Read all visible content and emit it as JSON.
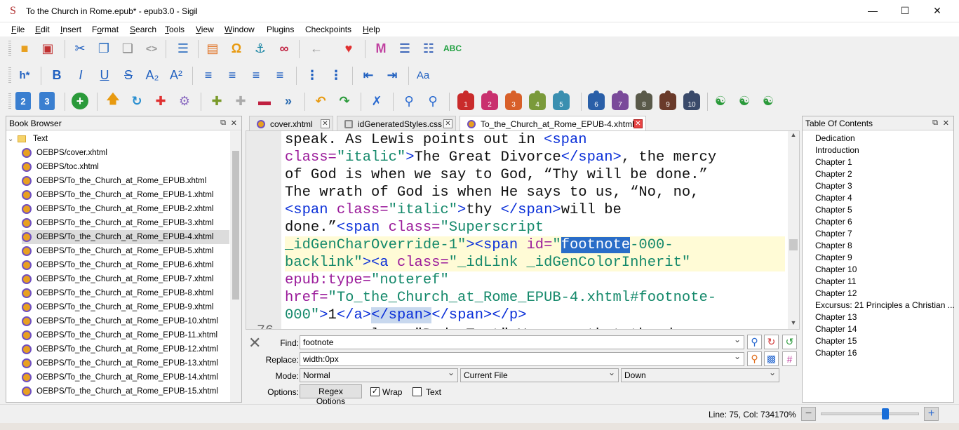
{
  "window": {
    "title": "To the Church in Rome.epub* - epub3.0 - Sigil",
    "minimize": "—",
    "maximize": "☐",
    "close": "✕",
    "app_icon": "sigil-icon"
  },
  "menu": [
    {
      "label": "File",
      "u": "F"
    },
    {
      "label": "Edit",
      "u": "E"
    },
    {
      "label": "Insert",
      "u": "I"
    },
    {
      "label": "Format",
      "u": "o"
    },
    {
      "label": "Search",
      "u": "S"
    },
    {
      "label": "Tools",
      "u": "T"
    },
    {
      "label": "View",
      "u": "V"
    },
    {
      "label": "Window",
      "u": "W"
    },
    {
      "label": "Plugins",
      "u": ""
    },
    {
      "label": "Checkpoints",
      "u": ""
    },
    {
      "label": "Help",
      "u": "H"
    }
  ],
  "toolbar": {
    "heading_label": "h*",
    "bold": "B",
    "italic": "I",
    "underline": "U",
    "strike": "S",
    "subscript": "A₂",
    "superscript": "A²",
    "case_label": "Aa",
    "toc_gen_1": "2",
    "toc_gen_2": "3",
    "plugins": [
      "1",
      "2",
      "3",
      "4",
      "5",
      "6",
      "7",
      "8",
      "9",
      "10"
    ],
    "plugin_colors": [
      "#c92b2b",
      "#c9306e",
      "#d8602a",
      "#7a9a3a",
      "#3a8fb0",
      "#2a5fa8",
      "#7a4a9a",
      "#5a5a4a",
      "#6a3a2a",
      "#3a4a6a"
    ]
  },
  "book_browser": {
    "title": "Book Browser",
    "folder": "Text",
    "files": [
      "OEBPS/cover.xhtml",
      "OEBPS/toc.xhtml",
      "OEBPS/To_the_Church_at_Rome_EPUB.xhtml",
      "OEBPS/To_the_Church_at_Rome_EPUB-1.xhtml",
      "OEBPS/To_the_Church_at_Rome_EPUB-2.xhtml",
      "OEBPS/To_the_Church_at_Rome_EPUB-3.xhtml",
      "OEBPS/To_the_Church_at_Rome_EPUB-4.xhtml",
      "OEBPS/To_the_Church_at_Rome_EPUB-5.xhtml",
      "OEBPS/To_the_Church_at_Rome_EPUB-6.xhtml",
      "OEBPS/To_the_Church_at_Rome_EPUB-7.xhtml",
      "OEBPS/To_the_Church_at_Rome_EPUB-8.xhtml",
      "OEBPS/To_the_Church_at_Rome_EPUB-9.xhtml",
      "OEBPS/To_the_Church_at_Rome_EPUB-10.xhtml",
      "OEBPS/To_the_Church_at_Rome_EPUB-11.xhtml",
      "OEBPS/To_the_Church_at_Rome_EPUB-12.xhtml",
      "OEBPS/To_the_Church_at_Rome_EPUB-13.xhtml",
      "OEBPS/To_the_Church_at_Rome_EPUB-14.xhtml",
      "OEBPS/To_the_Church_at_Rome_EPUB-15.xhtml"
    ],
    "selected_index": 6
  },
  "tabs": [
    {
      "label": "cover.xhtml",
      "active": false
    },
    {
      "label": "idGeneratedStyles.css",
      "active": false
    },
    {
      "label": "To_the_Church_at_Rome_EPUB-4.xhtml",
      "active": true
    }
  ],
  "editor": {
    "partial_line_number": "76",
    "lines": [
      [
        {
          "t": "speak. As Lewis points out in ",
          "c": ""
        },
        {
          "t": "<span",
          "c": "tg"
        }
      ],
      [
        {
          "t": "class=",
          "c": "at"
        },
        {
          "t": "\"italic\"",
          "c": "st"
        },
        {
          "t": ">",
          "c": "tg"
        },
        {
          "t": "The Great Divorce",
          "c": ""
        },
        {
          "t": "</span>",
          "c": "tg"
        },
        {
          "t": ", the mercy",
          "c": ""
        }
      ],
      [
        {
          "t": "of God is when we say to God, “Thy will be done.”",
          "c": ""
        }
      ],
      [
        {
          "t": "The wrath of God is when He says to us, “No, no,",
          "c": ""
        }
      ],
      [
        {
          "t": "<span ",
          "c": "tg"
        },
        {
          "t": "class=",
          "c": "at"
        },
        {
          "t": "\"italic\"",
          "c": "st"
        },
        {
          "t": ">",
          "c": "tg"
        },
        {
          "t": "thy ",
          "c": ""
        },
        {
          "t": "</span>",
          "c": "tg"
        },
        {
          "t": "will be",
          "c": ""
        }
      ],
      [
        {
          "t": "done.”",
          "c": ""
        },
        {
          "t": "<span ",
          "c": "tg"
        },
        {
          "t": "class=",
          "c": "at"
        },
        {
          "t": "\"Superscript",
          "c": "st"
        }
      ],
      [
        {
          "t": "_idGenCharOverride-1\"",
          "c": "st"
        },
        {
          "t": ">",
          "c": "tg"
        },
        {
          "t": "<span ",
          "c": "tg"
        },
        {
          "t": "id=",
          "c": "at"
        },
        {
          "t": "\"",
          "c": "st"
        },
        {
          "t": "footnote",
          "c": "sel"
        },
        {
          "t": "-000-",
          "c": "st"
        }
      ],
      [
        {
          "t": "backlink\"",
          "c": "st"
        },
        {
          "t": ">",
          "c": "tg"
        },
        {
          "t": "<a ",
          "c": "tg"
        },
        {
          "t": "class=",
          "c": "at"
        },
        {
          "t": "\"_idLink _idGenColorInherit\"",
          "c": "st"
        }
      ],
      [
        {
          "t": "epub:type=",
          "c": "at"
        },
        {
          "t": "\"noteref\"",
          "c": "st"
        }
      ],
      [
        {
          "t": "href=",
          "c": "at"
        },
        {
          "t": "\"To_the_Church_at_Rome_EPUB-4.xhtml#footnote-",
          "c": "st"
        }
      ],
      [
        {
          "t": "000\"",
          "c": "st"
        },
        {
          "t": ">",
          "c": "tg"
        },
        {
          "t": "1",
          "c": ""
        },
        {
          "t": "</a>",
          "c": "tg"
        },
        {
          "t": "</span>",
          "c": "tgh"
        },
        {
          "t": "</span>",
          "c": "tg"
        },
        {
          "t": "</p>",
          "c": "tg"
        }
      ],
      [
        {
          "t": "      <p class=\"Body-Text\">You see that the d",
          "c": ""
        }
      ]
    ]
  },
  "find": {
    "find_label": "Find:",
    "find_value": "footnote",
    "replace_label": "Replace:",
    "replace_value": "width:0px",
    "mode_label": "Mode:",
    "mode_value": "Normal",
    "scope_value": "Current File",
    "direction_value": "Down",
    "options_label": "Options:",
    "regex_button": "Regex Options",
    "wrap_label": "Wrap",
    "wrap_checked": "✓",
    "text_label": "Text",
    "text_checked": ""
  },
  "toc": {
    "title": "Table Of Contents",
    "items": [
      "Dedication",
      "Introduction",
      "Chapter 1",
      "Chapter 2",
      "Chapter 3",
      "Chapter 4",
      "Chapter 5",
      "Chapter 6",
      "Chapter 7",
      "Chapter 8",
      "Chapter 9",
      "Chapter 10",
      "Chapter 11",
      "Chapter 12",
      "Excursus: 21 Principles a Christian ...",
      "Chapter 13",
      "Chapter 14",
      "Chapter 15",
      "Chapter 16"
    ],
    "indent_index": [
      0,
      1
    ]
  },
  "status": {
    "position": "Line: 75, Col: 734",
    "zoom": "170%",
    "zoom_fraction": 0.65
  }
}
